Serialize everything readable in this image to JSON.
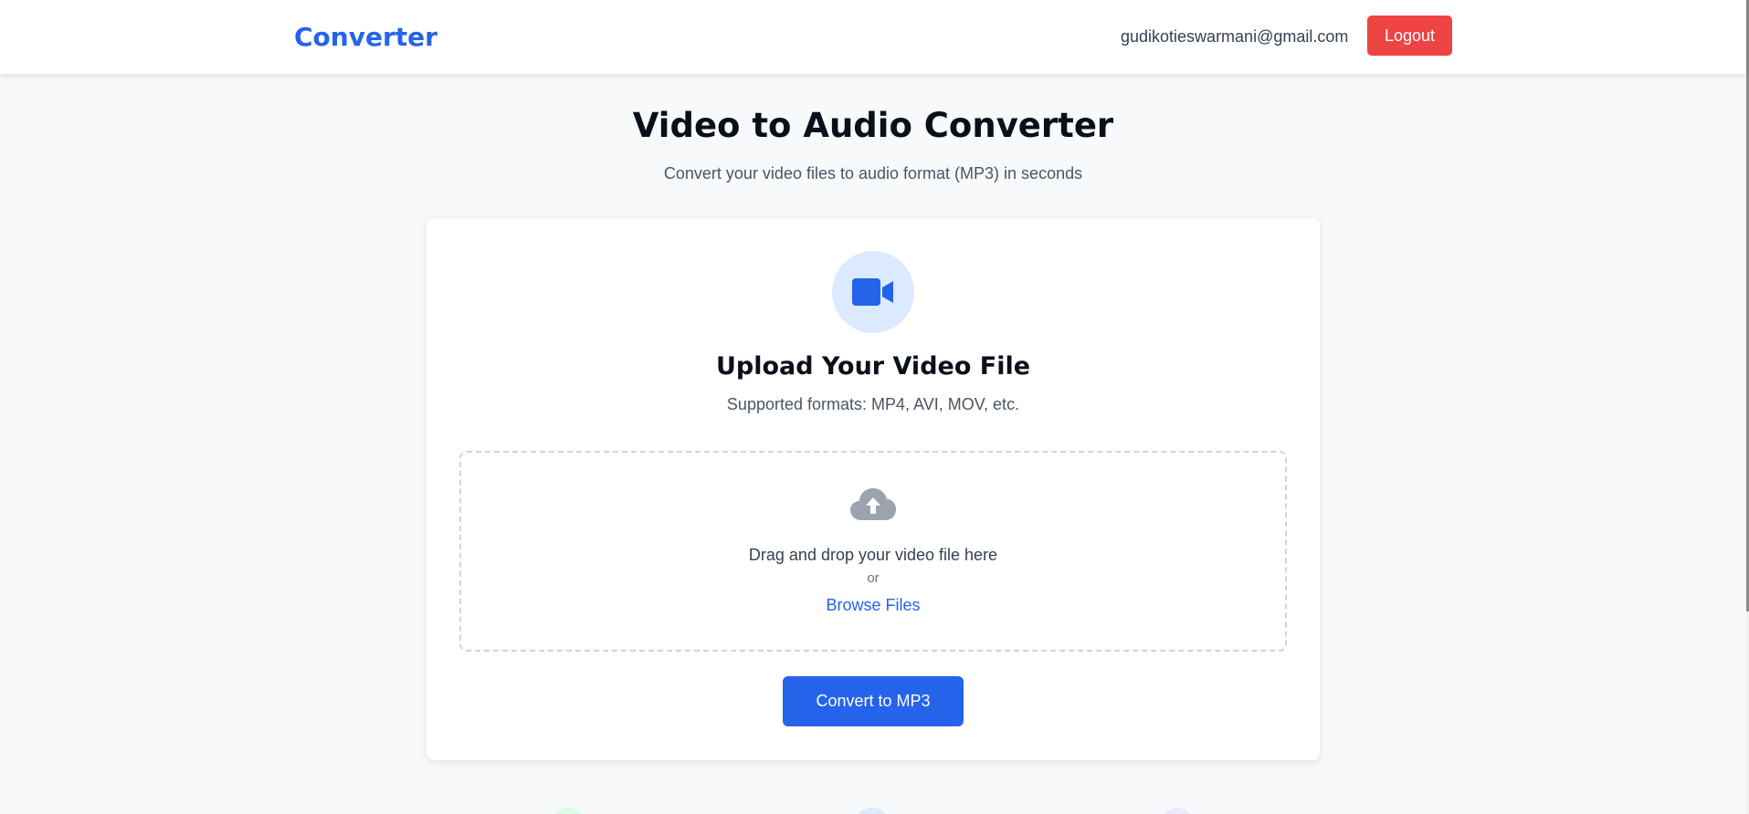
{
  "header": {
    "brand": "Converter",
    "user_email": "gudikotieswarmani@gmail.com",
    "logout_label": "Logout"
  },
  "main": {
    "title": "Video to Audio Converter",
    "subtitle": "Convert your video files to audio format (MP3) in seconds"
  },
  "upload_card": {
    "icon": "video-camera-icon",
    "title": "Upload Your Video File",
    "formats": "Supported formats: MP4, AVI, MOV, etc.",
    "dropzone": {
      "icon": "cloud-upload-icon",
      "instruction": "Drag and drop your video file here",
      "or_text": "or",
      "browse_label": "Browse Files"
    },
    "convert_label": "Convert to MP3"
  },
  "colors": {
    "accent": "#2563eb",
    "danger": "#ef4444",
    "icon_bg": "#dbeafe",
    "feature_green": "#dcfce7",
    "feature_blue": "#dbeafe",
    "feature_purple": "#ede9fe"
  }
}
